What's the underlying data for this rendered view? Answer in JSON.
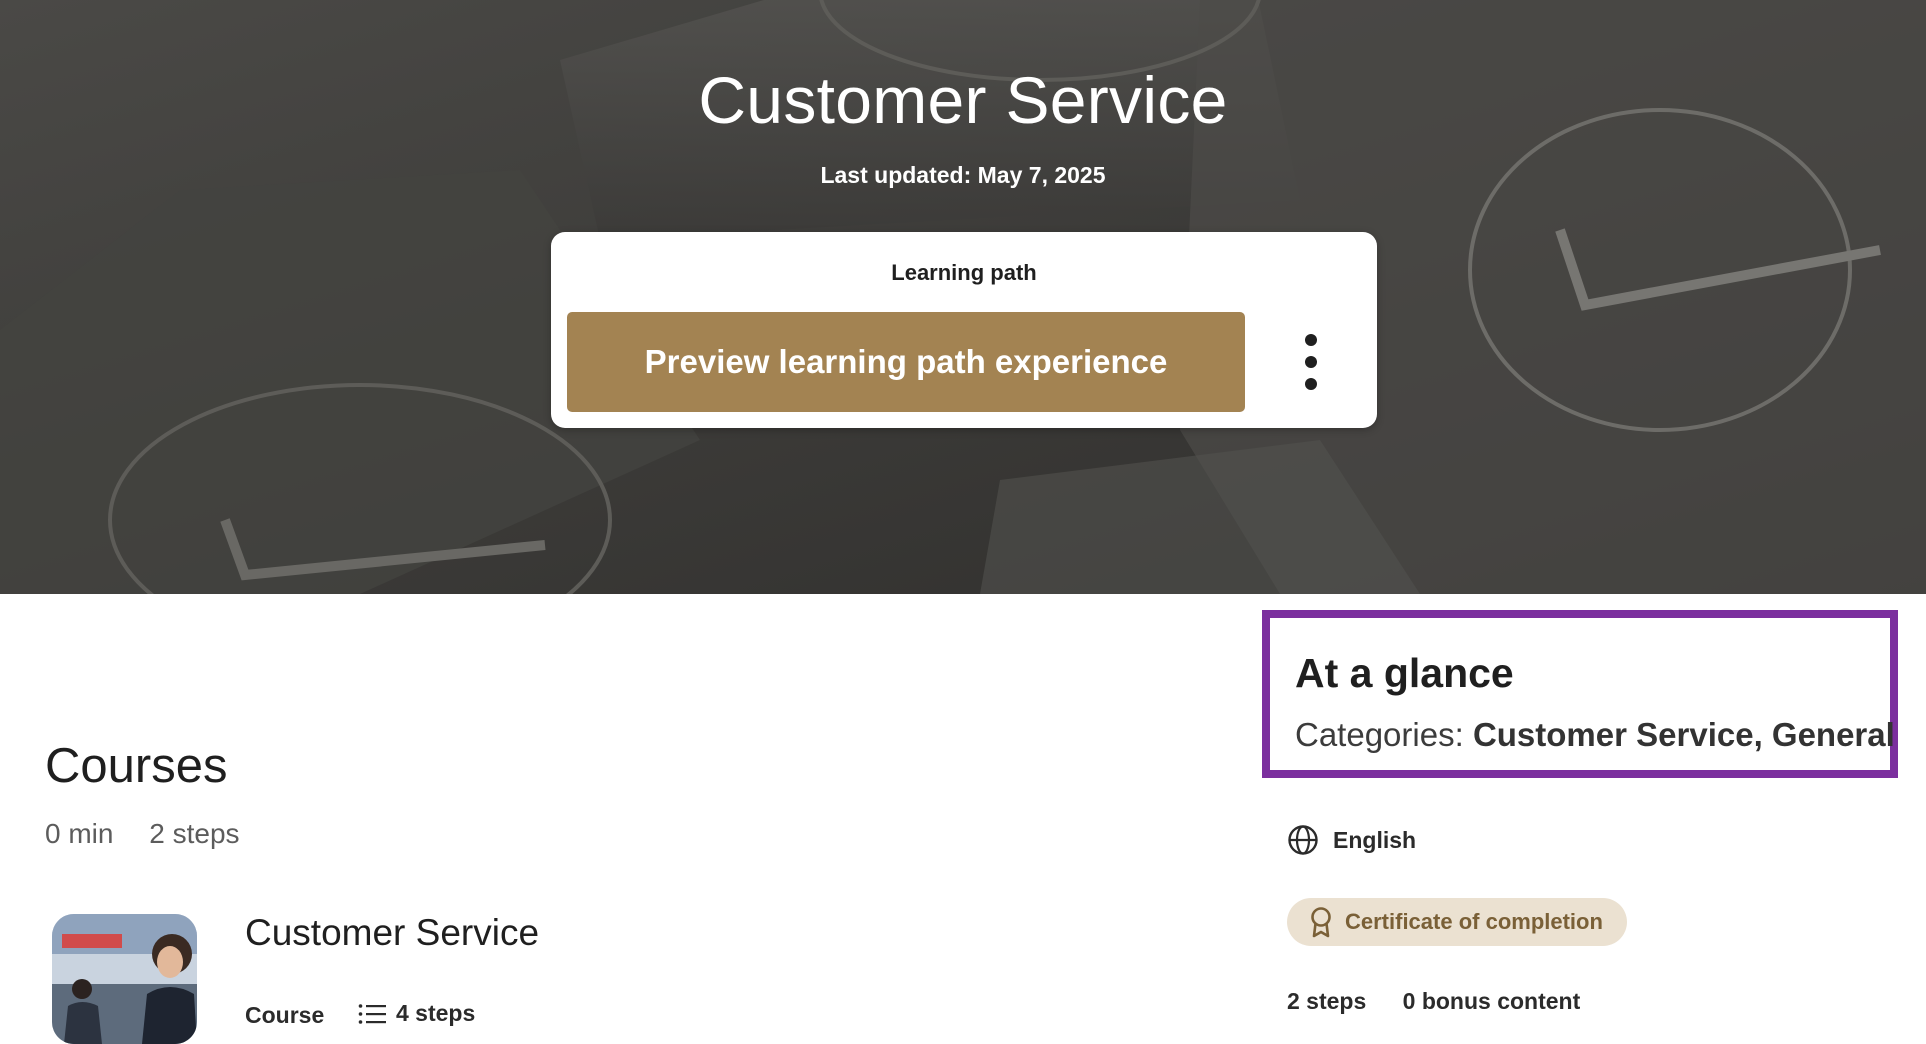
{
  "hero": {
    "title": "Customer Service",
    "last_updated": "Last updated: May 7, 2025"
  },
  "learning_path_card": {
    "label": "Learning path",
    "preview_button": "Preview learning path experience",
    "more_options_icon": "kebab-menu-icon",
    "button_color": "#a38352"
  },
  "courses": {
    "heading": "Courses",
    "duration": "0 min",
    "steps": "2 steps",
    "items": [
      {
        "title": "Customer Service",
        "type": "Course",
        "steps": "4 steps",
        "steps_icon": "list-icon"
      }
    ]
  },
  "at_a_glance": {
    "title": "At a glance",
    "categories_label": "Categories:",
    "categories_value": "Customer Service, General",
    "highlight_color": "#7b2f9e",
    "language_icon": "globe-icon",
    "language": "English",
    "certificate_icon": "award-ribbon-icon",
    "certificate": "Certificate of completion",
    "steps": "2 steps",
    "bonus": "0 bonus content"
  }
}
